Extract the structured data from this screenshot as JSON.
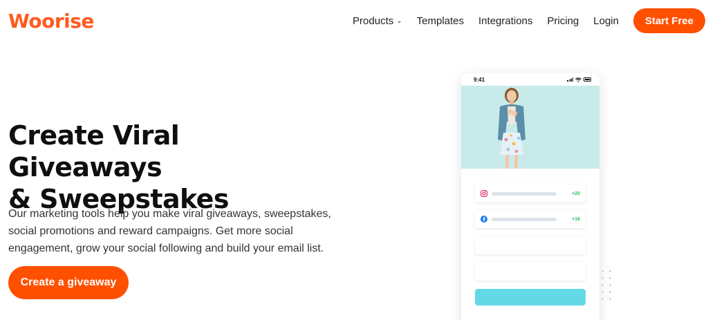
{
  "brand": {
    "name": "Woorise",
    "color": "#ff5a1f"
  },
  "nav": {
    "items": [
      {
        "label": "Products",
        "has_dropdown": true
      },
      {
        "label": "Templates"
      },
      {
        "label": "Integrations"
      },
      {
        "label": "Pricing"
      },
      {
        "label": "Login"
      }
    ],
    "cta_label": "Start Free"
  },
  "hero": {
    "title_line1": "Create Viral Giveaways",
    "title_line2": "& Sweepstakes",
    "description": "Our marketing tools help you make viral giveaways, sweepstakes, social promotions and reward campaigns. Get more social engagement, grow your social following and build your email list.",
    "cta_label": "Create a giveaway"
  },
  "phone": {
    "time": "9:41",
    "entries": [
      {
        "icon": "instagram-icon",
        "points": "+20"
      },
      {
        "icon": "facebook-icon",
        "points": "+16"
      }
    ]
  },
  "colors": {
    "accent": "#ff5000",
    "submit": "#63d9e6",
    "points": "#23c15c"
  }
}
